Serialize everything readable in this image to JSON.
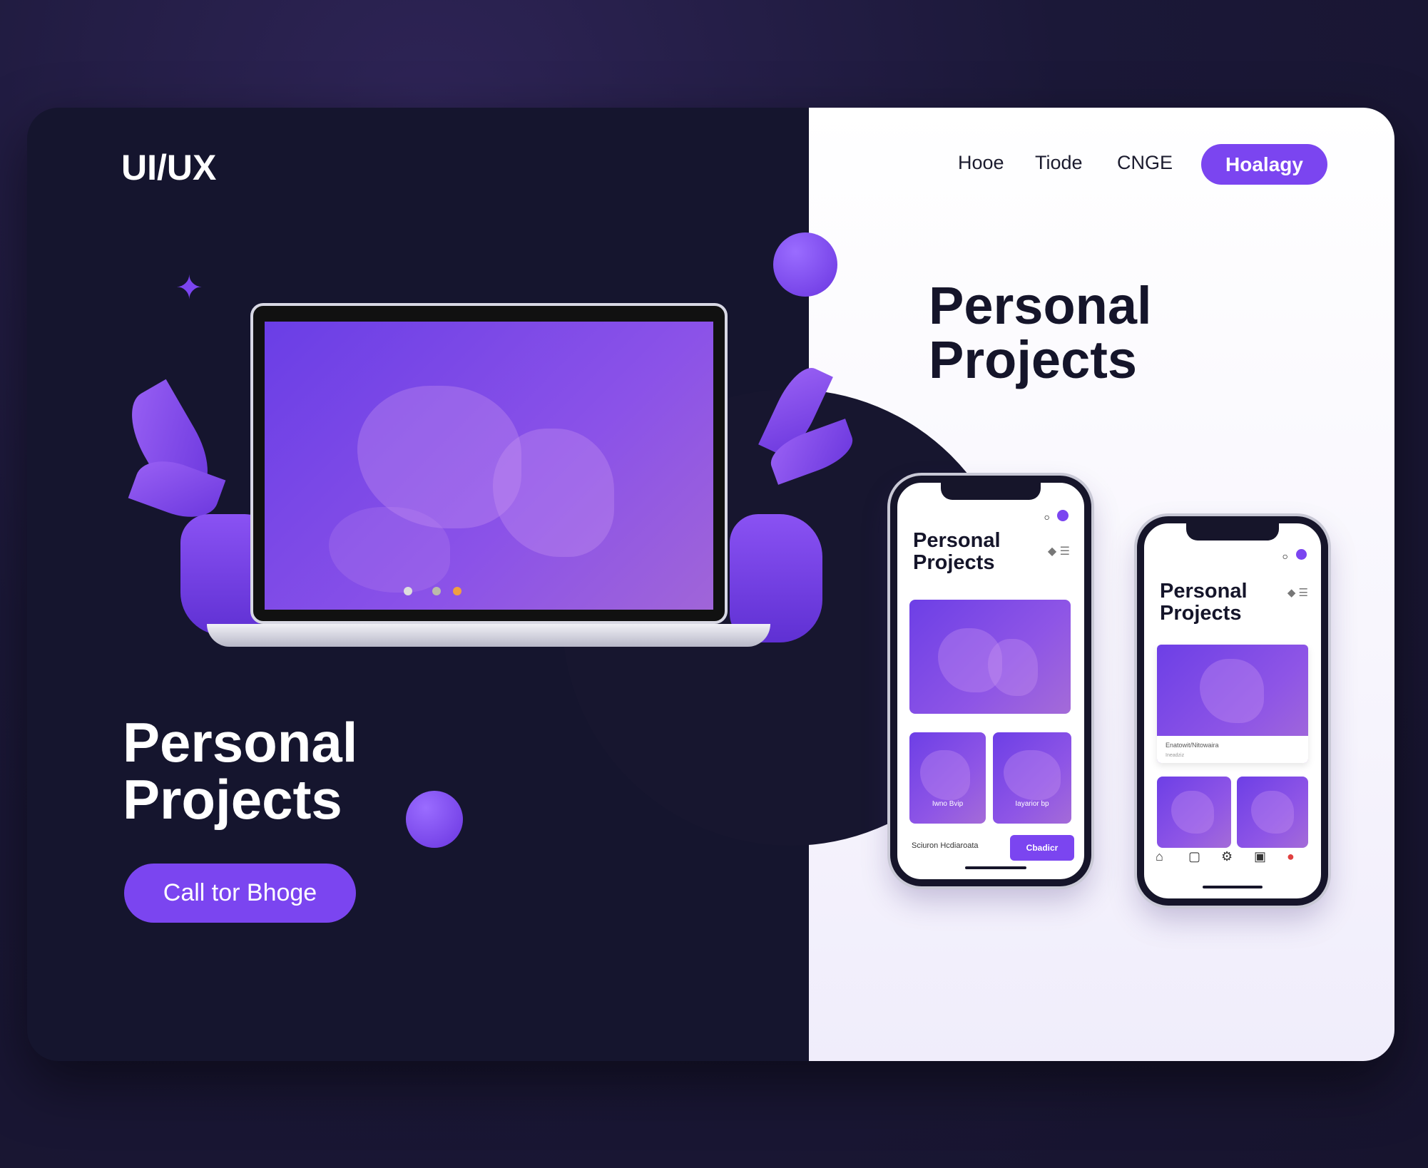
{
  "brand": {
    "logo": "UI/UX"
  },
  "nav": {
    "items": [
      "Hooe",
      "Tiode",
      "CNGE"
    ],
    "button": "Hoalagy"
  },
  "hero_right": {
    "title_line1": "Personal",
    "title_line2": "Projects"
  },
  "hero_left": {
    "title_line1": "Personal",
    "title_line2": "Projects",
    "cta": "Call tor Bhoge"
  },
  "phone1": {
    "title_line1": "Personal",
    "title_line2": "Projects",
    "card1_caption": "Iwno Bvip",
    "card2_caption": "Iayarior bp",
    "footer_text": "Sciuron Hcdiaroata",
    "footer_button": "Cbadicr"
  },
  "phone2": {
    "title_line1": "Personal",
    "title_line2": "Projects",
    "card_title": "Enatowit/Nitowaira",
    "card_sub": "Ineadziz"
  },
  "colors": {
    "accent": "#7b45f0",
    "dark": "#15152e",
    "dot_accent": "#f0a040"
  }
}
